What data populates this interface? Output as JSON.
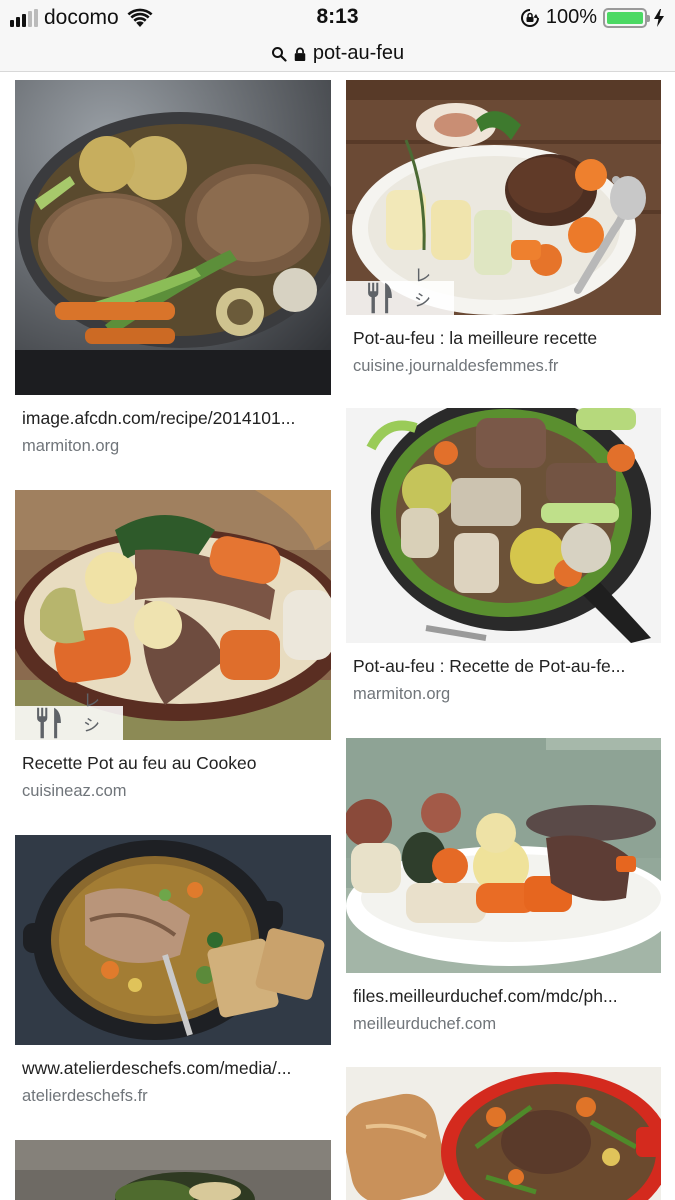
{
  "status_bar": {
    "carrier": "docomo",
    "time": "8:13",
    "battery": "100%",
    "battery_level": 1.0
  },
  "url_bar": {
    "url": "pot-au-feu"
  },
  "results": [
    {
      "title": "image.afcdn.com/recipe/2014101...",
      "domain": "marmiton.org",
      "badge": ""
    },
    {
      "title": "Pot-au-feu : la meilleure recette",
      "domain": "cuisine.journaldesfemmes.fr",
      "badge": "レシピ"
    },
    {
      "title": "Recette Pot au feu au Cookeo",
      "domain": "cuisineaz.com",
      "badge": "レシピ"
    },
    {
      "title": "Pot-au-feu : Recette de Pot-au-fe...",
      "domain": "marmiton.org",
      "badge": ""
    },
    {
      "title": "www.atelierdeschefs.com/media/...",
      "domain": "atelierdeschefs.fr",
      "badge": ""
    },
    {
      "title": "files.meilleurduchef.com/mdc/ph...",
      "domain": "meilleurduchef.com",
      "badge": ""
    },
    {
      "title": "",
      "domain": "",
      "badge": ""
    },
    {
      "title": "",
      "domain": "",
      "badge": ""
    }
  ],
  "icons": {
    "wifi": "wifi-icon",
    "rotation_lock": "rotation-lock-icon",
    "charging": "charging-bolt-icon",
    "search": "search-icon",
    "lock": "lock-icon",
    "recipe": "fork-knife-icon"
  },
  "colors": {
    "battery_fill": "#4cd964",
    "domain_text": "#70757a"
  }
}
